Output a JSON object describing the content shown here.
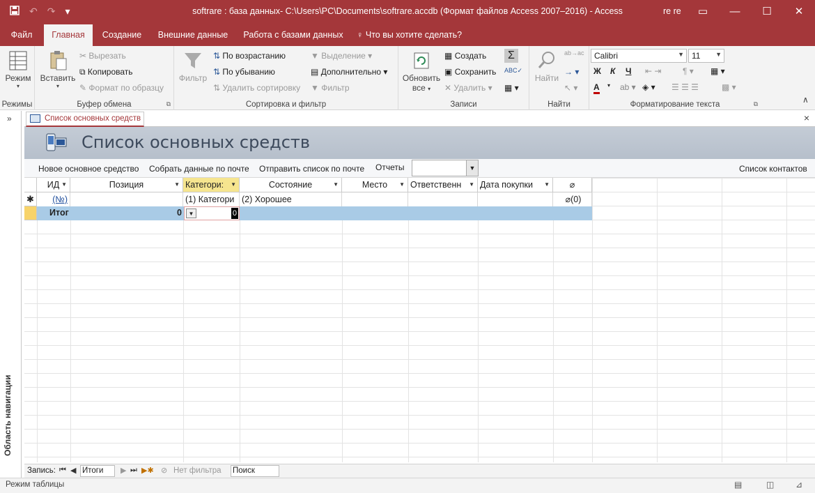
{
  "window": {
    "title": "softrare : база данных- C:\\Users\\PC\\Documents\\softrare.accdb (Формат файлов Access 2007–2016) - Access",
    "user": "re re",
    "qat_customize": "▾"
  },
  "ribbon_tabs": [
    "Файл",
    "Главная",
    "Создание",
    "Внешние данные",
    "Работа с базами данных"
  ],
  "tell_me": "Что вы хотите сделать?",
  "ribbon": {
    "views": {
      "label": "Режимы",
      "button": "Режим"
    },
    "clipboard": {
      "label": "Буфер обмена",
      "paste": "Вставить",
      "cut": "Вырезать",
      "copy": "Копировать",
      "format_painter": "Формат по образцу"
    },
    "sort_filter": {
      "label": "Сортировка и фильтр",
      "filter": "Фильтр",
      "ascending": "По возрастанию",
      "descending": "По убыванию",
      "remove_sort": "Удалить сортировку",
      "selection": "Выделение",
      "advanced": "Дополнительно",
      "toggle_filter": "Фильтр"
    },
    "records": {
      "label": "Записи",
      "refresh": "Обновить",
      "refresh2": "все",
      "new": "Создать",
      "save": "Сохранить",
      "delete": "Удалить"
    },
    "find": {
      "label": "Найти",
      "find": "Найти"
    },
    "text_format": {
      "label": "Форматирование текста",
      "font": "Calibri",
      "size": "11",
      "bold": "Ж",
      "italic": "К",
      "underline": "Ч",
      "font_color": "A"
    }
  },
  "nav_pane": {
    "label": "Область навигации",
    "toggle": "»"
  },
  "document": {
    "tab": "Список основных средств",
    "close": "×",
    "header_title": "Список основных средств",
    "toolbar": {
      "new_asset": "Новое основное средство",
      "collect_email": "Собрать данные по почте",
      "send_list": "Отправить список по почте",
      "reports": "Отчеты",
      "contacts": "Список контактов"
    }
  },
  "table": {
    "columns": [
      "ИД",
      "Позиция",
      "Категори:",
      "Состояние",
      "Место",
      "Ответственн",
      "Дата покупки"
    ],
    "new_row": {
      "marker": "✱",
      "id": "(№)",
      "category": "(1) Категори",
      "condition": "(2) Хорошее",
      "attachments": "(0)"
    },
    "total_row": {
      "label": "Итог",
      "position_total": "0",
      "category_total": "0"
    }
  },
  "record_nav": {
    "label": "Запись:",
    "current": "Итоги",
    "filter": "Нет фильтра",
    "search": "Поиск"
  },
  "statusbar": {
    "text": "Режим таблицы"
  },
  "colors": {
    "access_red": "#a4373a",
    "header_band": "#c0c8d2",
    "total_row": "#a9cbe6",
    "selected_header": "#f6e58f"
  }
}
